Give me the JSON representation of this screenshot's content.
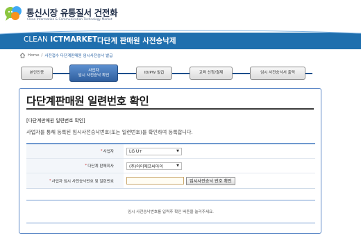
{
  "header": {
    "logo_title": "통신시장 유통질서 건전화",
    "logo_subtitle": "Clean Information & Communication Technology Market"
  },
  "banner": {
    "brand_light": "CLEAN ",
    "brand_bold": "ICTMARKET",
    "title": "다단계 판매원 사전승낙제"
  },
  "breadcrumb": {
    "home": "Home",
    "separator": "/",
    "current": "사전접수 다단계판매원 임시사전승낙 발급"
  },
  "steps": [
    {
      "line1": "본인인증",
      "line2": "",
      "active": false
    },
    {
      "line1": "사업자",
      "line2": "임시 사전승낙 확인",
      "active": true
    },
    {
      "line1": "ID/PW 발급",
      "line2": "",
      "active": false
    },
    {
      "line1": "교육 신청/결제",
      "line2": "",
      "active": false
    },
    {
      "line1": "임시 사전승낙서 출력",
      "line2": "",
      "active": false
    }
  ],
  "panel": {
    "title": "다단계판매원 일련번호 확인",
    "section_label": "[다단계판매원 일련번호 확인]",
    "description": "사업자를 통해 등록된 임시사전승낙번호(또는 일련번호)를 확인하여 등록합니다."
  },
  "form": {
    "required_mark": "*",
    "operator_label": "사업자",
    "operator_value": "LG U+",
    "company_label": "다단계 판매회사",
    "company_value": "(주)아이에프씨아이",
    "serial_label": "사업자 임시 사전승낙번호 및 일련번호",
    "serial_value": "",
    "check_button": "임시사전승낙 번호 확인",
    "dropdown_arrow": "▼"
  },
  "result": {
    "message": "임시 사전승낙번호를 입력후 확인 버튼을 눌러주세요."
  },
  "colors": {
    "banner": "#1f6fae",
    "accent_blue": "#2f5f9e",
    "panel_border": "#5a86c6"
  }
}
